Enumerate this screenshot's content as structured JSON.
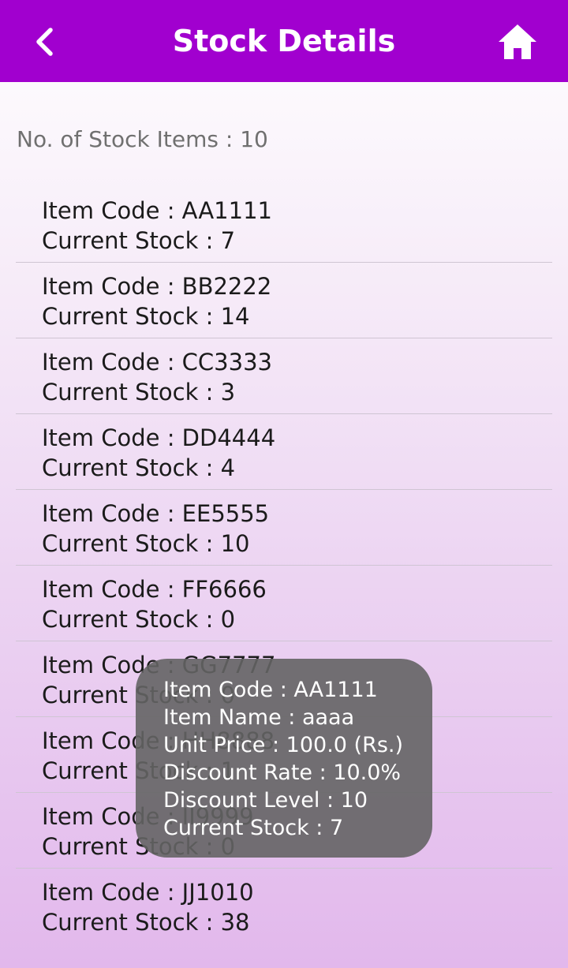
{
  "header": {
    "title": "Stock Details",
    "back_icon": "chevron-left-icon",
    "home_icon": "home-icon",
    "bar_color": "#a100cf"
  },
  "summary": {
    "count_text": "No. of Stock Items : 10"
  },
  "items": [
    {
      "code": "Item Code : AA1111",
      "stock": "Current Stock : 7"
    },
    {
      "code": "Item Code : BB2222",
      "stock": "Current Stock : 14"
    },
    {
      "code": "Item Code : CC3333",
      "stock": "Current Stock : 3"
    },
    {
      "code": "Item Code : DD4444",
      "stock": "Current Stock : 4"
    },
    {
      "code": "Item Code : EE5555",
      "stock": "Current Stock : 10"
    },
    {
      "code": "Item Code : FF6666",
      "stock": "Current Stock : 0"
    },
    {
      "code": "Item Code : GG7777",
      "stock": "Current Stock : 0"
    },
    {
      "code": "Item Code : HH8888",
      "stock": "Current Stock : 1"
    },
    {
      "code": "Item Code : II9999",
      "stock": "Current Stock : 0"
    },
    {
      "code": "Item Code : JJ1010",
      "stock": "Current Stock : 38"
    }
  ],
  "toast": {
    "lines": [
      "Item Code : AA1111",
      "Item Name : aaaa",
      "Unit Price : 100.0 (Rs.)",
      "Discount Rate : 10.0%",
      "Discount Level : 10",
      "Current Stock : 7"
    ]
  }
}
